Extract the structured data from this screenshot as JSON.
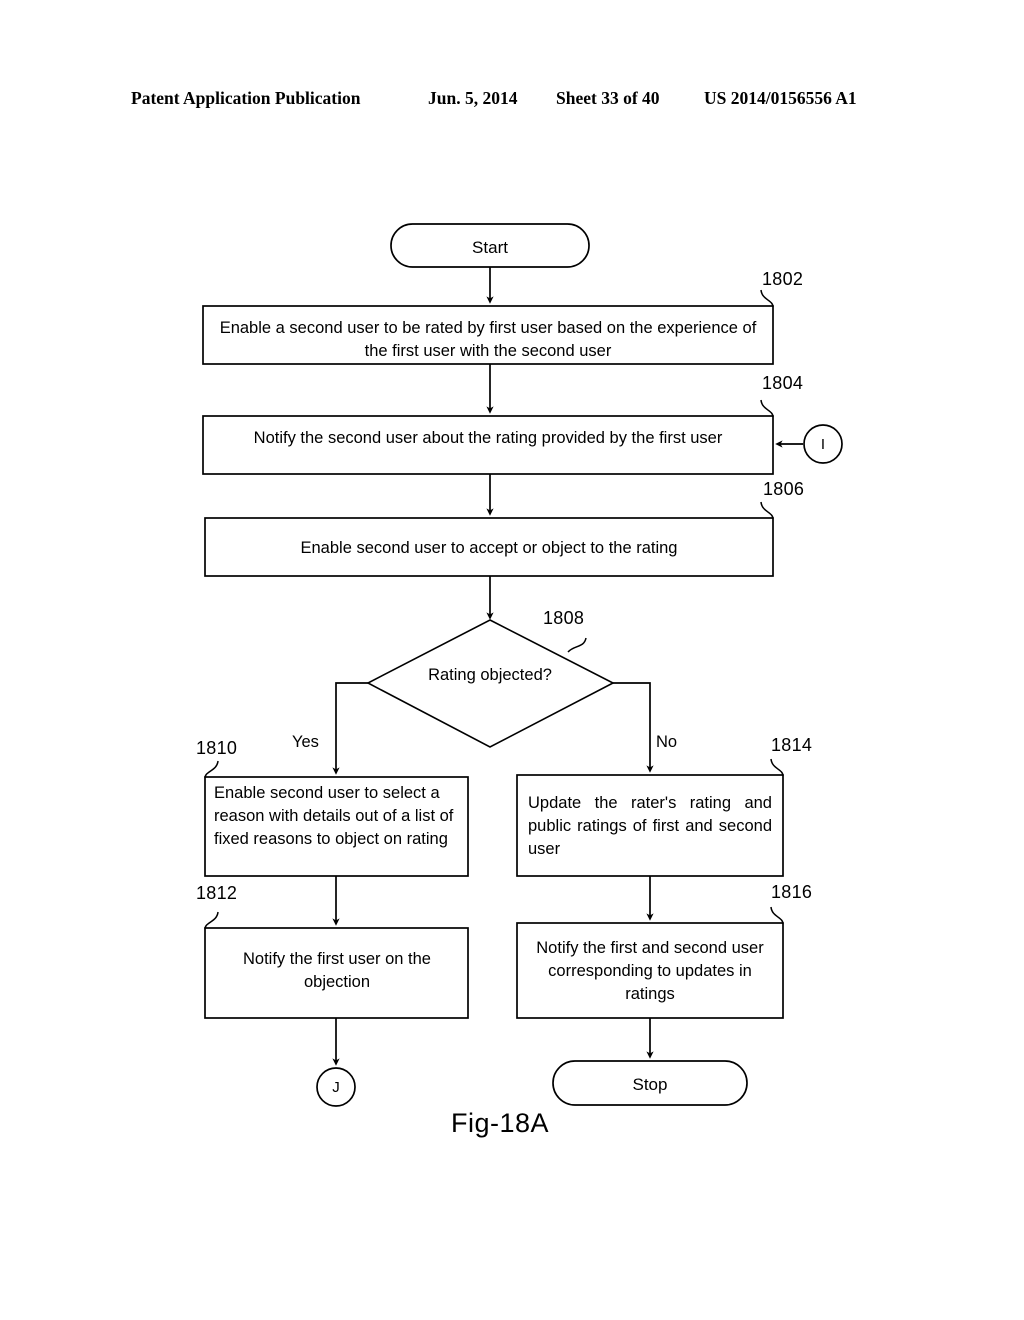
{
  "header": {
    "publication": "Patent Application Publication",
    "date": "Jun. 5, 2014",
    "sheet": "Sheet 33 of 40",
    "patent_number": "US 2014/0156556 A1"
  },
  "figure": {
    "caption": "Fig-18A",
    "type": "flowchart"
  },
  "nodes": {
    "start": {
      "label": "Start",
      "shape": "terminator"
    },
    "step_1802": {
      "ref": "1802",
      "shape": "process",
      "text": "Enable a second user to be rated by first user based on the experience of the first user with the second user"
    },
    "step_1804": {
      "ref": "1804",
      "shape": "process",
      "text": "Notify the second user about the rating provided by the first user"
    },
    "step_1806": {
      "ref": "1806",
      "shape": "process",
      "text": "Enable second user to accept or object to the rating"
    },
    "decision_1808": {
      "ref": "1808",
      "shape": "decision",
      "text": "Rating objected?",
      "yes_label": "Yes",
      "no_label": "No"
    },
    "step_1810": {
      "ref": "1810",
      "shape": "process",
      "text": "Enable second user to select a reason with details out of a list of fixed reasons to object on rating"
    },
    "step_1812": {
      "ref": "1812",
      "shape": "process",
      "text": "Notify the first user on the objection"
    },
    "step_1814": {
      "ref": "1814",
      "shape": "process",
      "text": "Update the rater's rating and public ratings of first and second user"
    },
    "step_1816": {
      "ref": "1816",
      "shape": "process",
      "text": "Notify the first and second user corresponding to updates in ratings"
    },
    "connector_in": {
      "label": "I",
      "shape": "connector"
    },
    "connector_out": {
      "label": "J",
      "shape": "connector"
    },
    "stop": {
      "label": "Stop",
      "shape": "terminator"
    }
  },
  "colors": {
    "stroke": "#000000",
    "background": "#ffffff",
    "text": "#000000"
  }
}
